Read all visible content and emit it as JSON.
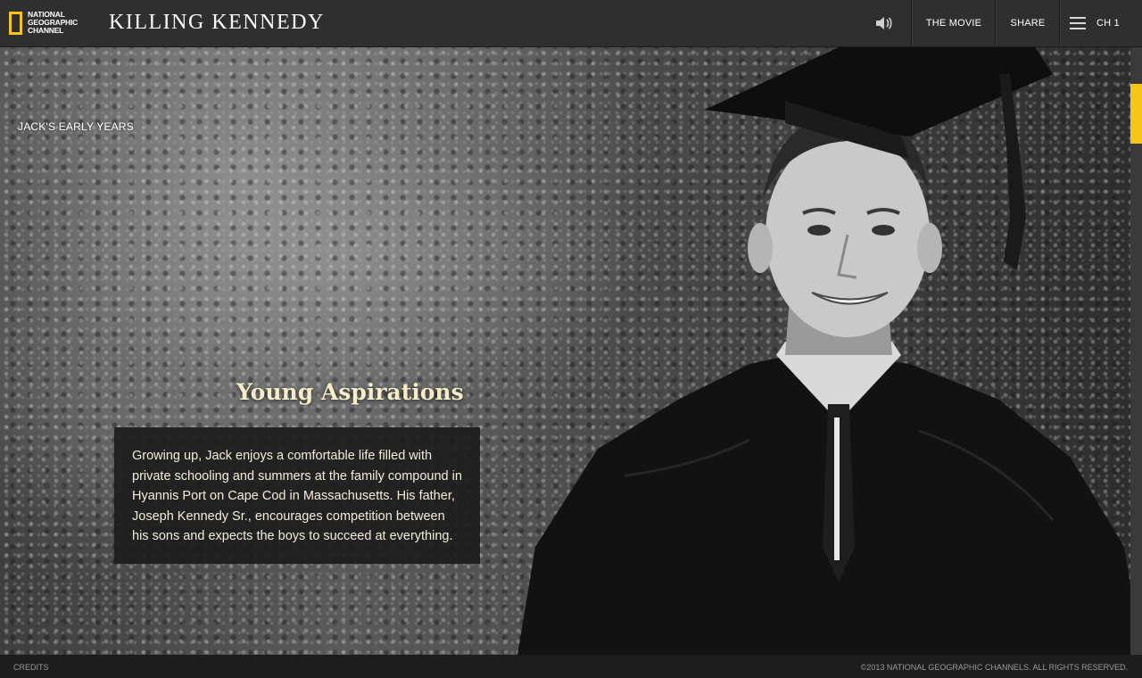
{
  "header": {
    "logo_text": "NATIONAL GEOGRAPHIC CHANNEL",
    "site_title": "KILLING KENNEDY",
    "nav": {
      "sound_icon": "speaker-icon",
      "movie_label": "THE MOVIE",
      "share_label": "SHARE",
      "menu_icon": "hamburger-icon",
      "chapter_label": "CH 1"
    }
  },
  "hero": {
    "section_label": "JACK'S EARLY YEARS",
    "card_title": "Young Aspirations",
    "card_text": "Growing up, Jack enjoys a comfortable life filled with private schooling and summers at the family compound in Hyannis Port on Cape Cod in Massachusetts. His father, Joseph Kennedy Sr., encourages competition between his sons and expects the boys to succeed at everything."
  },
  "footer": {
    "credits_label": "CREDITS",
    "copyright": "©2013 NATIONAL GEOGRAPHIC CHANNELS. ALL RIGHTS RESERVED."
  },
  "colors": {
    "accent": "#f5c518",
    "title_text": "#f6ecc8",
    "topbar": "#2f2f2f"
  }
}
